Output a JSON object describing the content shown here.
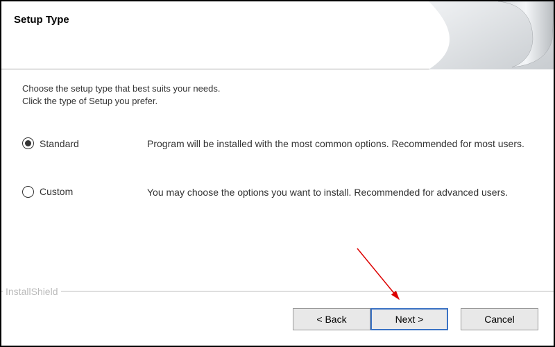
{
  "header": {
    "title": "Setup Type"
  },
  "intro": {
    "line1": "Choose the setup type that best suits your needs.",
    "line2": "Click the type of Setup you prefer."
  },
  "options": [
    {
      "id": "standard",
      "label": "Standard",
      "description": "Program will be installed with the most common options. Recommended for most users.",
      "selected": true
    },
    {
      "id": "custom",
      "label": "Custom",
      "description": "You may choose the options you want to install. Recommended for advanced users.",
      "selected": false
    }
  ],
  "footer": {
    "brand": "InstallShield"
  },
  "buttons": {
    "back": "< Back",
    "next": "Next >",
    "cancel": "Cancel"
  }
}
